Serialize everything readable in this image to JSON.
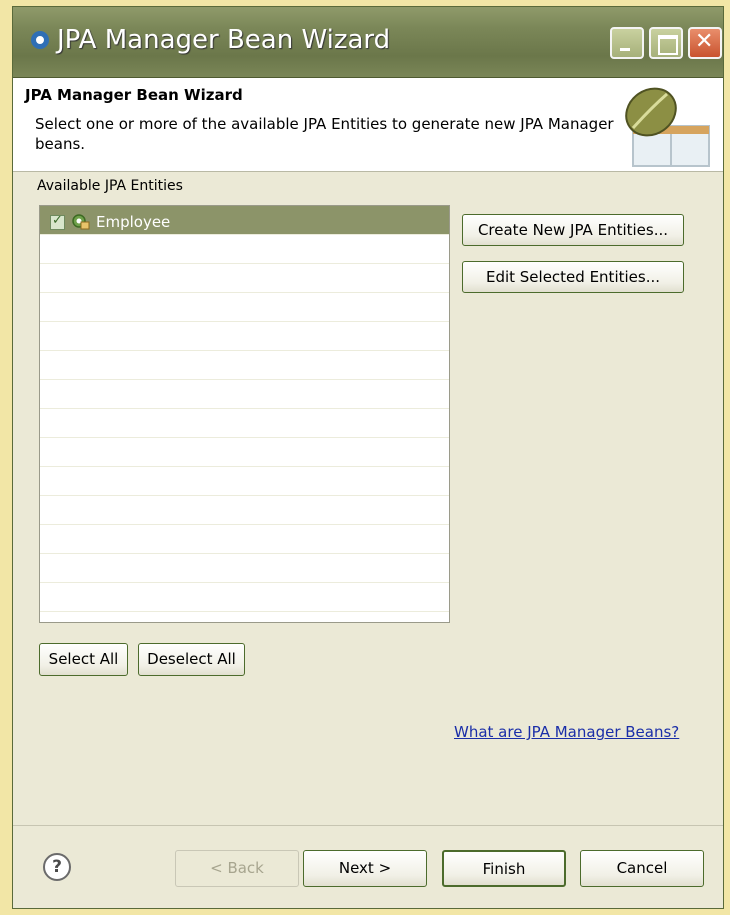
{
  "window": {
    "title": "JPA Manager Bean Wizard"
  },
  "header": {
    "title": "JPA Manager Bean Wizard",
    "description": "Select one or more of the available JPA Entities to generate new JPA Manager beans."
  },
  "entities": {
    "label": "Available JPA Entities",
    "items": [
      {
        "label": "Employee",
        "checked": true,
        "selected": true
      }
    ]
  },
  "actions": {
    "create_label": "Create New JPA Entities...",
    "edit_label": "Edit Selected Entities..."
  },
  "selection": {
    "select_all_label": "Select All",
    "deselect_all_label": "Deselect All"
  },
  "help_link": "What are JPA Manager Beans?",
  "footer": {
    "help_icon": "help-icon",
    "back_label": "< Back",
    "next_label": "Next >",
    "finish_label": "Finish",
    "cancel_label": "Cancel"
  }
}
